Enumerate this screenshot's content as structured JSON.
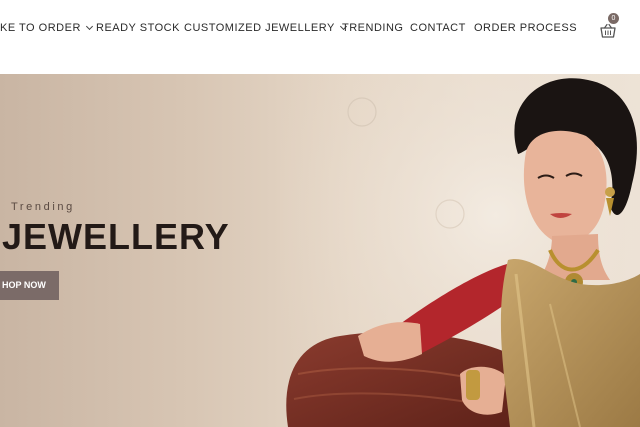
{
  "nav": {
    "items": [
      {
        "label": "KE TO ORDER",
        "has_dropdown": true
      },
      {
        "label": "READY STOCK",
        "has_dropdown": false
      },
      {
        "label": "CUSTOMIZED JEWELLERY",
        "has_dropdown": true
      },
      {
        "label": "TRENDING",
        "has_dropdown": false
      },
      {
        "label": "CONTACT",
        "has_dropdown": false
      },
      {
        "label": "ORDER PROCESS",
        "has_dropdown": false
      }
    ],
    "cart": {
      "icon": "basket-icon",
      "count": "0"
    }
  },
  "hero": {
    "kicker": "Trending",
    "headline": "JEWELLERY",
    "button_label": "HOP NOW",
    "colors": {
      "button_bg": "#7b6b68",
      "blouse": "#b3262c",
      "saree": "#b8955a"
    }
  }
}
